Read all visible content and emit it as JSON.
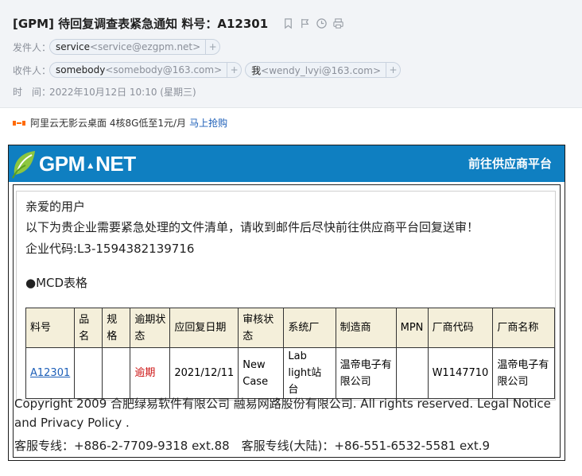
{
  "header": {
    "subject": "[GPM] 待回复调查表紧急通知 料号：A12301",
    "sender_label": "发件人：",
    "sender": {
      "name": "service",
      "email": "<service@ezgpm.net>"
    },
    "recipient_label": "收件人：",
    "recipients": [
      {
        "name": "somebody",
        "email": "<somebody@163.com>"
      },
      {
        "name": "我",
        "email": "<wendy_lvyi@163.com>"
      }
    ],
    "time_label": "时　间：",
    "time": "2022年10月12日 10:10 (星期三)",
    "plus": "+"
  },
  "ad": {
    "text": "阿里云无影云桌面 4核8G低至1元/月",
    "link": "马上抢购"
  },
  "email": {
    "logo": {
      "text1": "GPM",
      "text2": "NET",
      "tri": "▲"
    },
    "portal_link": "前往供应商平台",
    "greeting": "亲爱的用户",
    "intro": "以下为贵企业需要紧急处理的文件清单，请收到邮件后尽快前往供应商平台回复送审！",
    "company_code": "企业代码:L3-1594382139716",
    "section_title": "●MCD表格",
    "table": {
      "headers": [
        "料号",
        "品名",
        "规格",
        "逾期状态",
        "应回复日期",
        "审核状态",
        "系统厂",
        "制造商",
        "MPN",
        "厂商代码",
        "厂商名称"
      ],
      "rows": [
        {
          "part_no": "A12301",
          "name": "",
          "spec": "",
          "overdue": "逾期",
          "due_date": "2021/12/11",
          "review": "New Case",
          "system": "Lab light站台",
          "manufacturer": "温帝电子有限公司",
          "mpn": "",
          "vendor_code": "W1147710",
          "vendor_name": "温帝电子有限公司"
        }
      ]
    },
    "copyright": "Copyright 2009 合肥绿易软件有限公司 融易网路股份有限公司. All rights reserved. Legal Notice",
    "copyright2": "and Privacy Policy .",
    "hotline": "客服专线：+886-2-7709-9318 ext.88　客服专线(大陆)：+86-551-6532-5581 ext.9"
  },
  "colors": {
    "banner": "#0f7fc1",
    "header_bg": "#f2f4f7",
    "table_header": "#f4efda",
    "link": "#1d5fb8",
    "overdue": "#cc1111"
  }
}
